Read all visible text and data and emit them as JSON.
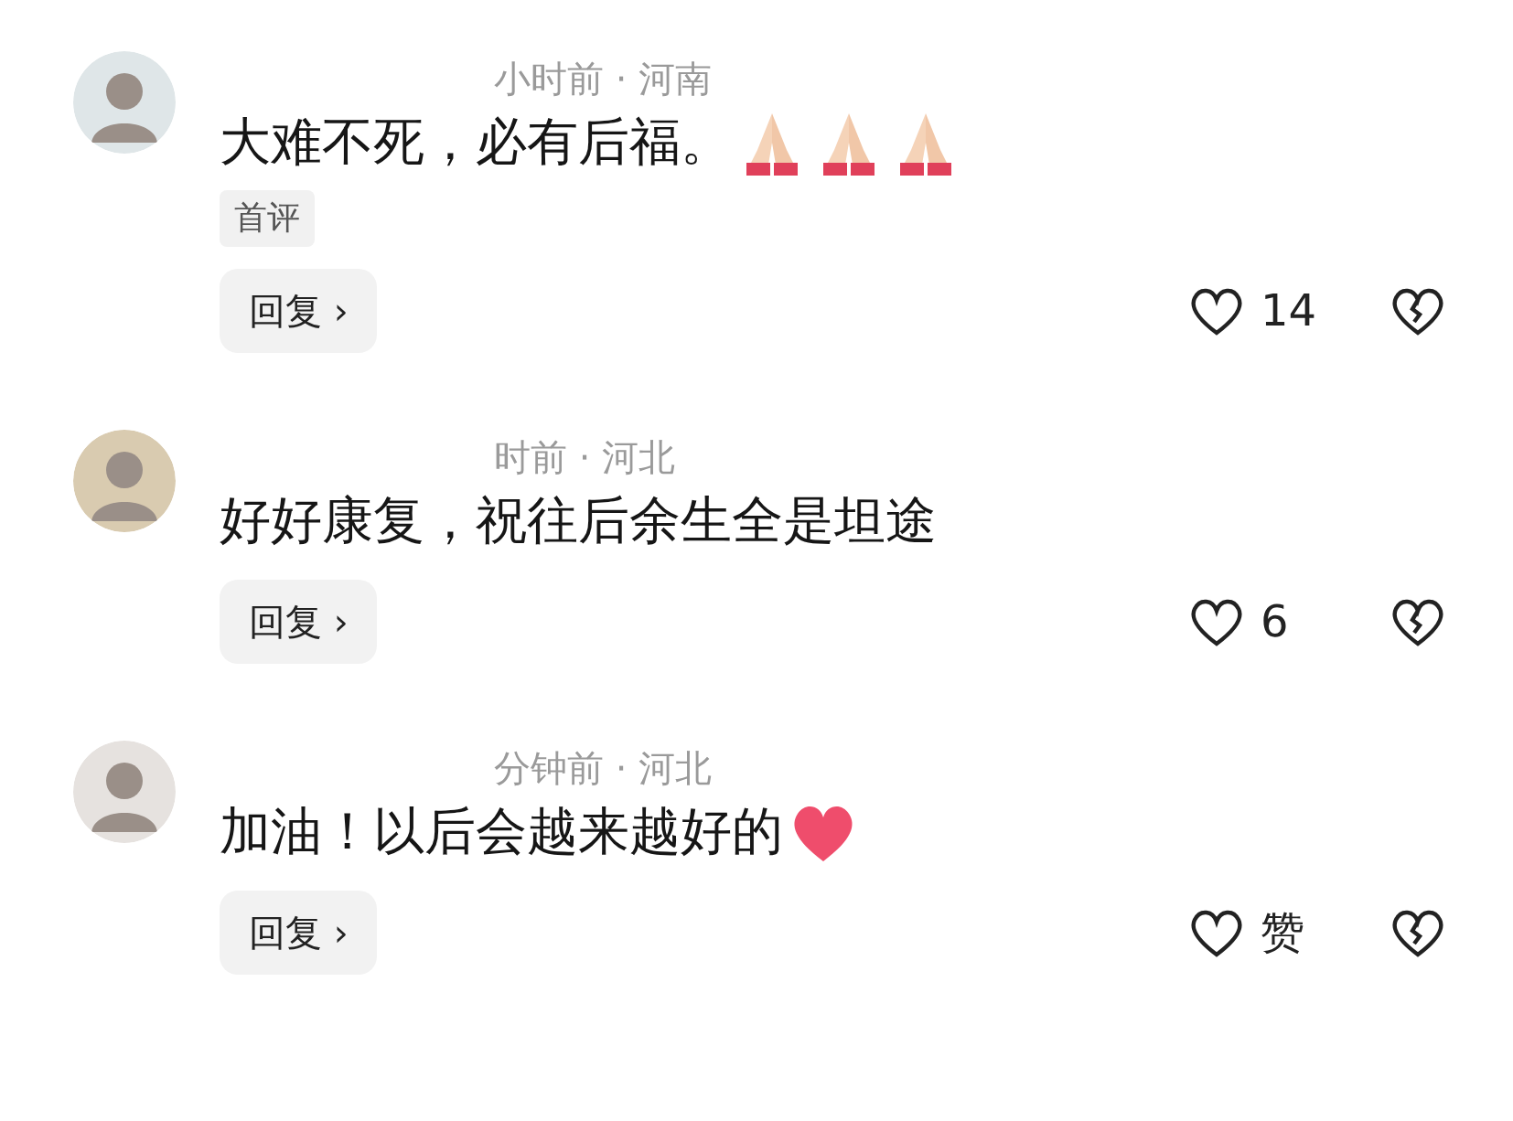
{
  "comments": [
    {
      "meta": "小时前 · 河南",
      "text": "大难不死，必有后福。",
      "emojis": [
        {
          "kind": "praying-hands"
        },
        {
          "kind": "praying-hands"
        },
        {
          "kind": "praying-hands"
        }
      ],
      "tag": "首评",
      "reply": "回复",
      "chevron": "›",
      "likes": "14"
    },
    {
      "meta": "时前 · 河北",
      "text": "好好康复，祝往后余生全是坦途",
      "reply": "回复",
      "chevron": "›",
      "likes": "6"
    },
    {
      "meta": "分钟前 · 河北",
      "text": "加油！以后会越来越好的",
      "emojis": [
        {
          "kind": "red-heart"
        }
      ],
      "reply": "回复",
      "chevron": "›",
      "likes": "赞"
    }
  ]
}
